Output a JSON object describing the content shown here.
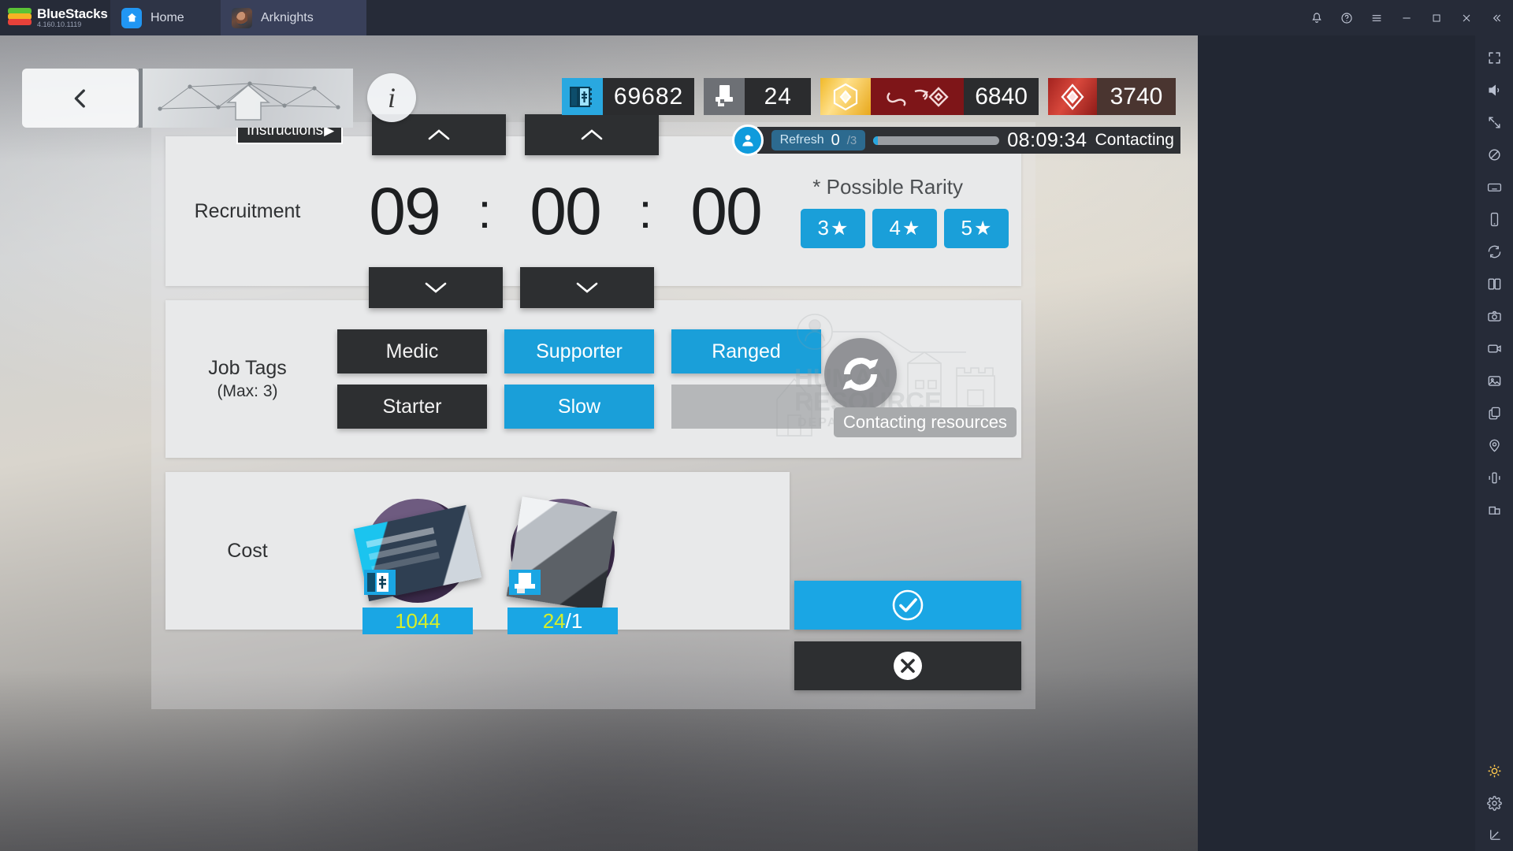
{
  "titlebar": {
    "brand": "BlueStacks",
    "version": "4.160.10.1119",
    "tabs": [
      {
        "label": "Home",
        "icon": "home-icon"
      },
      {
        "label": "Arknights",
        "icon": "app-icon"
      }
    ],
    "window_buttons": [
      "bell-icon",
      "help-icon",
      "menu-icon",
      "minimize-icon",
      "maximize-icon",
      "close-icon",
      "collapse-icon"
    ]
  },
  "sidebar": {
    "items": [
      "fullscreen-icon",
      "volume-icon",
      "resize-icon",
      "eyedropper-icon",
      "keyboard-icon",
      "phone-icon",
      "rotate-icon",
      "multi-instance-icon",
      "screenshot-icon",
      "record-icon",
      "gallery-icon",
      "copy-icon",
      "location-icon",
      "shake-icon",
      "layers-icon"
    ],
    "bottom_items": [
      "brightness-icon",
      "settings-icon",
      "trim-icon"
    ]
  },
  "topbar": {
    "back_label": "back-arrow",
    "banner_label": "network-home-banner",
    "info_label": "i",
    "resources": [
      {
        "name": "recruitment-permit",
        "value": "69682"
      },
      {
        "name": "expedited-plan",
        "value": "24"
      },
      {
        "name": "lmd-gold",
        "value": "6840"
      },
      {
        "name": "originium",
        "value": "3740"
      }
    ],
    "refresh": {
      "label": "Refresh",
      "current": "0",
      "separator": "/",
      "total": "3"
    },
    "timer": "08:09:34",
    "status": "Contacting"
  },
  "dialog": {
    "instructions_label": "Instructions",
    "instructions_arrow": "▶",
    "recruitment": {
      "label": "Recruitment",
      "hours": "09",
      "minutes": "00",
      "seconds": "00",
      "colon": ":",
      "spinner_up_icon": "chevron-up-icon",
      "spinner_down_icon": "chevron-down-icon",
      "possible_rarity_label": "* Possible Rarity",
      "rarities": [
        {
          "num": "3",
          "star": "★",
          "active": true
        },
        {
          "num": "4",
          "star": "★",
          "active": true
        },
        {
          "num": "5",
          "star": "★",
          "active": true
        }
      ]
    },
    "job_tags": {
      "label": "Job Tags",
      "sub_label": "(Max: 3)",
      "tags": [
        {
          "label": "Medic",
          "selected": false
        },
        {
          "label": "Supporter",
          "selected": true
        },
        {
          "label": "Ranged",
          "selected": true
        },
        {
          "label": "Starter",
          "selected": false
        },
        {
          "label": "Slow",
          "selected": true
        },
        {
          "label": "",
          "selected": false,
          "empty": true
        }
      ],
      "watermark": "HUMAN RESOURCE DEPARTMENT",
      "refresh_icon": "refresh-circle-icon",
      "contact_button": "Contacting resources"
    },
    "cost": {
      "label": "Cost",
      "items": [
        {
          "name": "recruitment-permit",
          "value": "1044",
          "suffix": ""
        },
        {
          "name": "expedited-plan",
          "value": "24",
          "suffix": "/1"
        }
      ]
    },
    "actions": {
      "confirm_icon": "check-icon",
      "cancel_icon": "cross-icon"
    }
  },
  "colors": {
    "accent_blue": "#1aa6e4",
    "dark_button": "#2d2f31",
    "panel_bg": "#e8e9ea",
    "disabled_gray": "#b5b7b9",
    "cost_value": "#d6ee2a"
  }
}
